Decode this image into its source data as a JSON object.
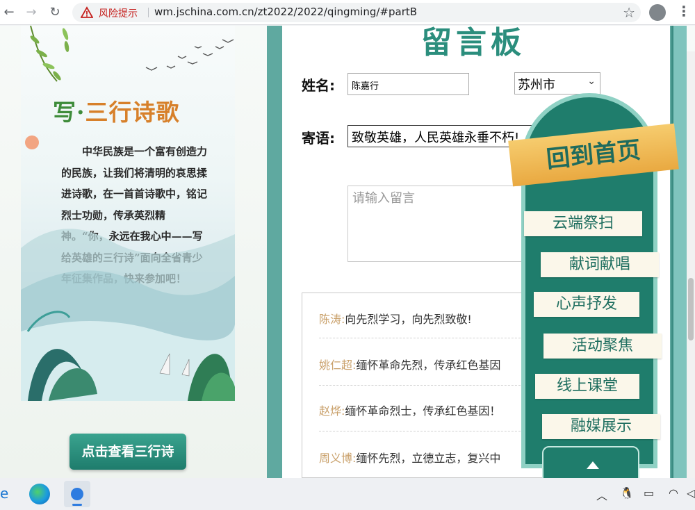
{
  "browser": {
    "risk_label": "风险提示",
    "url": "wm.jschina.com.cn/zt2022/2022/qingming/#partB"
  },
  "left_panel": {
    "title_part1": "写",
    "title_dot": "·",
    "title_part2": "三行诗歌",
    "intro": "中华民族是一个富有创造力的民族，让我们将清明的哀思揉进诗歌，在一首首诗歌中，铭记烈士功勋，传承英烈精神。“你，永远在我心中——写给英雄的三行诗”面向全省青少年征集作品，快来参加吧！",
    "view_button": "点击查看三行诗"
  },
  "board": {
    "title": "留言板",
    "name_label": "姓名:",
    "name_value": "陈嘉行",
    "city_value": "苏州市",
    "message_label": "寄语:",
    "message_value": "致敬英雄，人民英雄永垂不朽!",
    "textarea_placeholder": "请输入留言",
    "comments": [
      {
        "name": "陈涛:",
        "text": "向先烈学习，向先烈致敬!"
      },
      {
        "name": "姚仁超:",
        "text": "缅怀革命先烈，传承红色基因"
      },
      {
        "name": "赵烨:",
        "text": "缅怀革命烈士，传承红色基因！"
      },
      {
        "name": "周义博:",
        "text": "缅怀先烈，立德立志，复兴中"
      }
    ]
  },
  "float_nav": {
    "home": "回到首页",
    "items": [
      "云端祭扫",
      "献词献唱",
      "心声抒发",
      "活动聚焦",
      "线上课堂",
      "融媒展示"
    ]
  }
}
